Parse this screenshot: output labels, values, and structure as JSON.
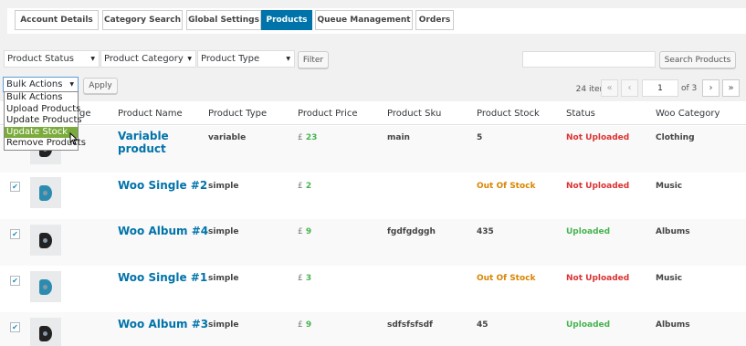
{
  "tabs": [
    {
      "label": "Account Details",
      "active": false
    },
    {
      "label": "Category Search",
      "active": false
    },
    {
      "label": "Global Settings",
      "active": false
    },
    {
      "label": "Products",
      "active": true
    },
    {
      "label": "Queue Management",
      "active": false
    },
    {
      "label": "Orders",
      "active": false
    }
  ],
  "filters": {
    "status": "Product Status",
    "category": "Product Category",
    "type": "Product Type",
    "filter_button": "Filter",
    "search_placeholder": "",
    "search_button": "Search Products"
  },
  "bulk": {
    "selected": "Bulk Actions",
    "options": [
      "Bulk Actions",
      "Upload Products",
      "Update Products",
      "Update Stock",
      "Remove Products"
    ],
    "highlighted": "Update Stock",
    "apply_button": "Apply"
  },
  "pagination": {
    "items": "24 items",
    "first": "«",
    "prev": "‹",
    "current": "1",
    "of": "of 3",
    "next": "›",
    "last": "»"
  },
  "table": {
    "headers": {
      "image": "ge",
      "name": "Product Name",
      "type": "Product Type",
      "price": "Product Price",
      "sku": "Product Sku",
      "stock": "Product Stock",
      "status": "Status",
      "woo": "Woo Category"
    },
    "currency": "£",
    "rows": [
      {
        "name": "Variable product",
        "type": "variable",
        "price": "23",
        "sku": "main",
        "stock": "5",
        "status": "Not Uploaded",
        "woo": "Clothing",
        "checked": false
      },
      {
        "name": "Woo Single #2",
        "type": "simple",
        "price": "2",
        "sku": "",
        "stock": "Out Of Stock",
        "status": "Not Uploaded",
        "woo": "Music",
        "checked": true
      },
      {
        "name": "Woo Album #4",
        "type": "simple",
        "price": "9",
        "sku": "fgdfgdggh",
        "stock": "435",
        "status": "Uploaded",
        "woo": "Albums",
        "checked": true
      },
      {
        "name": "Woo Single #1",
        "type": "simple",
        "price": "3",
        "sku": "",
        "stock": "Out Of Stock",
        "status": "Not Uploaded",
        "woo": "Music",
        "checked": true
      },
      {
        "name": "Woo Album #3",
        "type": "simple",
        "price": "9",
        "sku": "sdfsfsfsdf",
        "stock": "45",
        "status": "Uploaded",
        "woo": "Albums",
        "checked": true
      }
    ]
  },
  "colors": {
    "accent": "#0073aa",
    "uploaded": "#46b450",
    "not_uploaded": "#dc3232",
    "out_of_stock": "#d98500"
  }
}
